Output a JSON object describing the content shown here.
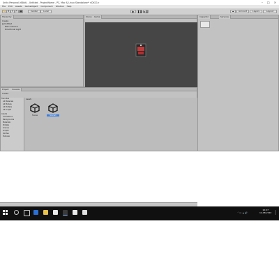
{
  "window": {
    "title": "Unity Personal (64bit) - Untitled - ProjectName - PC, Mac & Linux Standalone* <DX11>"
  },
  "menubar": {
    "items": [
      "File",
      "Edit",
      "Assets",
      "GameObject",
      "Component",
      "Window",
      "Help"
    ]
  },
  "toolbar": {
    "center_label": "Center",
    "local_label": "Local",
    "account_label": "Account",
    "layers_label": "Layers",
    "layout_label": "Layout"
  },
  "hierarchy": {
    "tab_label": "Hierarchy",
    "create_label": "Create",
    "scene_name": "Untitled",
    "items": [
      "Main Camera",
      "Directional Light"
    ]
  },
  "scene": {
    "tab_scene": "Scene",
    "tab_game": "Game"
  },
  "inspector": {
    "tab_label": "Inspector",
    "tab2_label": "Services"
  },
  "project": {
    "tab_project": "Project",
    "tab_console": "Console",
    "create_label": "Create",
    "breadcrumb": "Assets",
    "tree": [
      "Favorites",
      "All Materials",
      "All Models",
      "All Prefabs",
      "All Scripts",
      "Assets",
      "Animations",
      "Backgrounds",
      "Materials",
      "Prefabs",
      "Scenes",
      "Scripts",
      "Sprites",
      "Textures"
    ],
    "assets": [
      {
        "label": "Scene",
        "selected": false
      },
      {
        "label": "Scene1",
        "selected": true
      }
    ]
  },
  "taskbar": {
    "time": "10:27",
    "date": "12-08-2016"
  },
  "colors": {
    "scene_bg": "#464646",
    "selected": "#3d7fdf",
    "taskbar": "#101010"
  }
}
